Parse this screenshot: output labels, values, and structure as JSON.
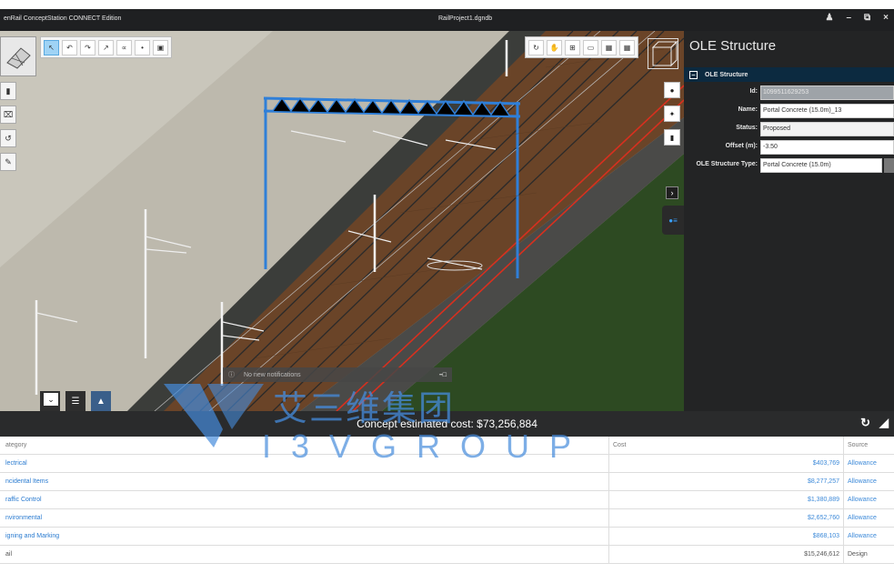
{
  "window": {
    "app_title": "enRail ConceptStation CONNECT Edition",
    "document_title": "RailProject1.dgndb",
    "controls": [
      "people-icon",
      "minimize-icon",
      "restore-icon",
      "close-icon"
    ]
  },
  "viewport": {
    "notification": "No new notifications",
    "view_toolbar_icons": [
      "rotate-icon",
      "pan-icon",
      "zoom-icon",
      "window-icon",
      "grid-icon",
      "grid-alt-icon"
    ],
    "select_toolbar_icons": [
      "select-icon",
      "undo-icon",
      "redo-icon",
      "pointer-icon",
      "measure-icon",
      "pin-icon",
      "delete-icon"
    ],
    "bottom_tab_icons": [
      "image-icon",
      "layers-icon",
      "rail-tool-icon"
    ],
    "colors": {
      "selected_structure": "#2f7fd8",
      "rail_red": "#d7301f",
      "terrain_green": "#2d4a22"
    }
  },
  "panel": {
    "title": "OLE Structure",
    "section_title": "OLE Structure",
    "fields": {
      "id": {
        "label": "Id:",
        "value": "1099511629253"
      },
      "name": {
        "label": "Name:",
        "value": "Portal Concrete (15.0m)_13"
      },
      "status": {
        "label": "Status:",
        "value": "Proposed"
      },
      "offset": {
        "label": "Offset (m):",
        "value": "-3.50"
      },
      "type": {
        "label": "OLE Structure Type:",
        "value": "Portal Concrete (15.0m)"
      }
    }
  },
  "cost": {
    "summary": "Concept estimated cost: $73,256,884",
    "headers": {
      "category": "ategory",
      "cost": "Cost",
      "source": "Source"
    },
    "rows": [
      {
        "category": "lectrical",
        "cost": "$403,769",
        "source": "Allowance"
      },
      {
        "category": "ncidental Items",
        "cost": "$8,277,257",
        "source": "Allowance"
      },
      {
        "category": "raffic Control",
        "cost": "$1,380,889",
        "source": "Allowance"
      },
      {
        "category": "nvironmental",
        "cost": "$2,652,760",
        "source": "Allowance"
      },
      {
        "category": "igning and Marking",
        "cost": "$868,103",
        "source": "Allowance"
      },
      {
        "category": "ail",
        "cost": "$15,246,612",
        "source": "Design"
      }
    ]
  },
  "watermark": {
    "cn": "艾三维集团",
    "en": "I3VGROUP"
  }
}
